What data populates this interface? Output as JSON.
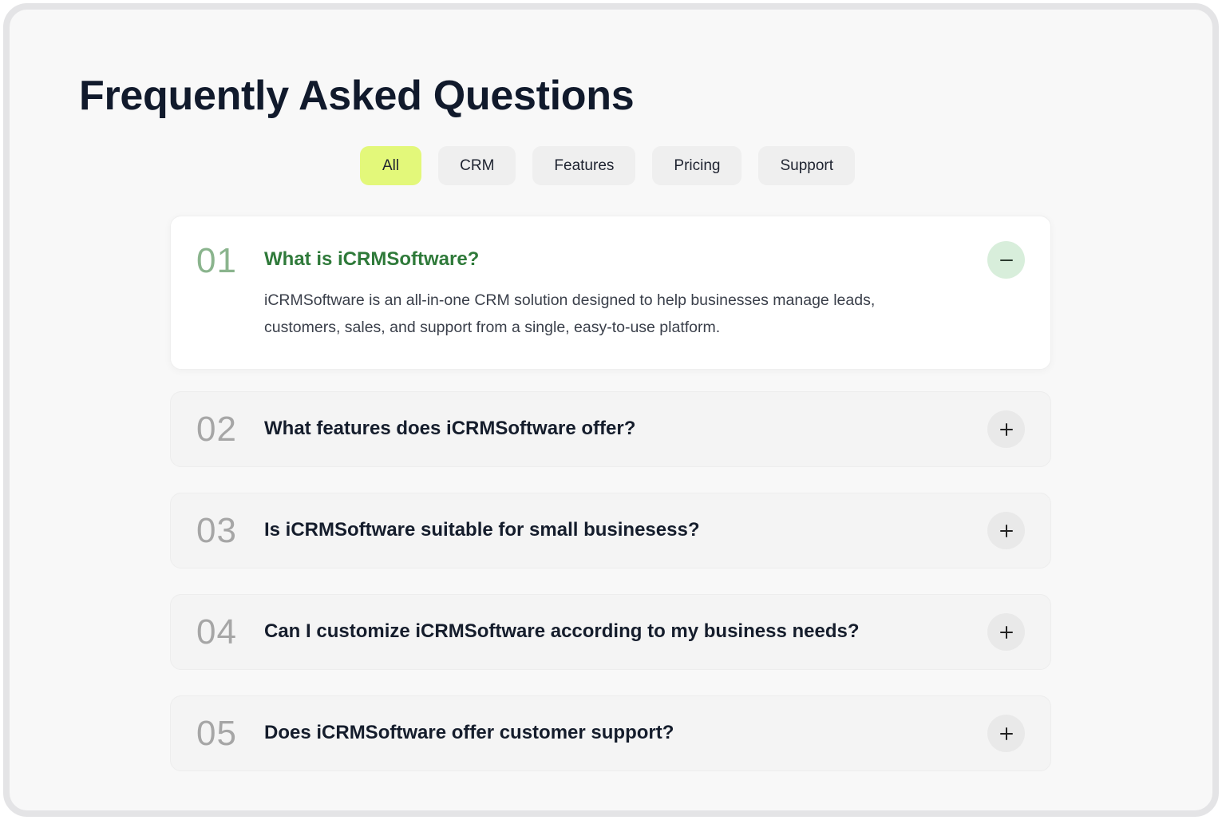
{
  "page": {
    "title": "Frequently Asked Questions"
  },
  "filters": {
    "tabs": [
      {
        "label": "All",
        "active": true
      },
      {
        "label": "CRM",
        "active": false
      },
      {
        "label": "Features",
        "active": false
      },
      {
        "label": "Pricing",
        "active": false
      },
      {
        "label": "Support",
        "active": false
      }
    ]
  },
  "faq": {
    "items": [
      {
        "number": "01",
        "question": "What is iCRMSoftware?",
        "answer": "iCRMSoftware is an all-in-one CRM solution designed to help businesses manage leads, customers, sales, and support from a single, easy-to-use platform.",
        "expanded": true,
        "icon": "minus-icon"
      },
      {
        "number": "02",
        "question": "What features does iCRMSoftware offer?",
        "expanded": false,
        "icon": "plus-icon"
      },
      {
        "number": "03",
        "question": "Is iCRMSoftware suitable for small businesess?",
        "expanded": false,
        "icon": "plus-icon"
      },
      {
        "number": "04",
        "question": "Can I customize iCRMSoftware according to my business needs?",
        "expanded": false,
        "icon": "plus-icon"
      },
      {
        "number": "05",
        "question": "Does iCRMSoftware offer customer support?",
        "expanded": false,
        "icon": "plus-icon"
      }
    ]
  },
  "colors": {
    "active_tab": "#e3f87a",
    "open_question": "#2f7a3a",
    "open_number": "#8ab48d",
    "open_toggle_bg": "#d8eedb",
    "title": "#111a2c"
  }
}
